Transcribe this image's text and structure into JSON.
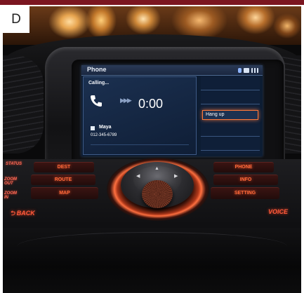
{
  "badge": {
    "letter": "D"
  },
  "screen": {
    "title": "Phone",
    "status_icons": [
      "bluetooth-icon",
      "battery-icon",
      "signal-icon"
    ],
    "call_status": "Calling...",
    "timer": "0:00",
    "contact_name": "Maya",
    "contact_number": "012-345-6789",
    "menu": {
      "hang_up": "Hang up"
    }
  },
  "controls": {
    "status_label": "STATUS",
    "zoom_out_label": "ZOOM OUT",
    "zoom_in_label": "ZOOM IN",
    "buttons_left": [
      "DEST",
      "ROUTE",
      "MAP"
    ],
    "buttons_right": [
      "PHONE",
      "INFO",
      "SETTING"
    ],
    "back": "⮌ BACK",
    "voice": "VOICE"
  },
  "colors": {
    "accent": "#ff6a3a",
    "frame_bar": "#7b1620",
    "screen_bg": "#0d1d33"
  }
}
